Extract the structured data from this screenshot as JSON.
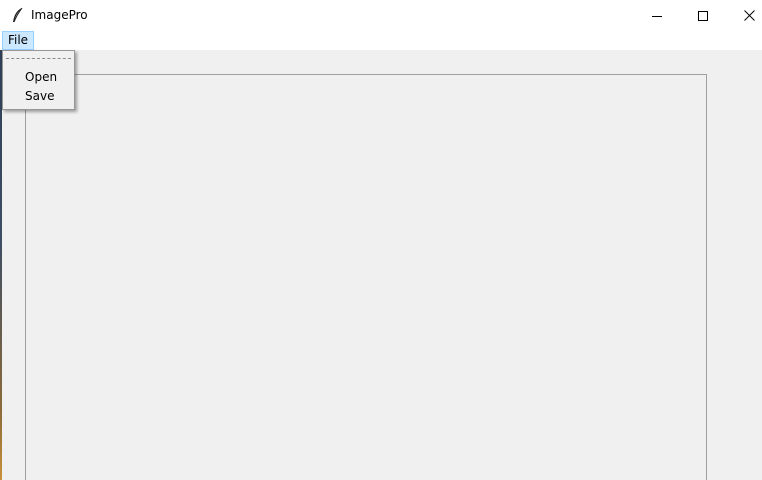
{
  "window": {
    "title": "ImagePro",
    "app_icon": "feather-icon",
    "controls": {
      "minimize_icon": "minimize-icon",
      "maximize_icon": "maximize-icon",
      "close_icon": "close-icon"
    }
  },
  "menubar": {
    "items": [
      {
        "label": "File",
        "active": true
      }
    ]
  },
  "file_menu": {
    "items": [
      {
        "label": "Open"
      },
      {
        "label": "Save"
      }
    ]
  },
  "colors": {
    "menu_highlight": "#cce8ff",
    "menu_highlight_border": "#99d1ff",
    "background": "#f0f0f0"
  }
}
